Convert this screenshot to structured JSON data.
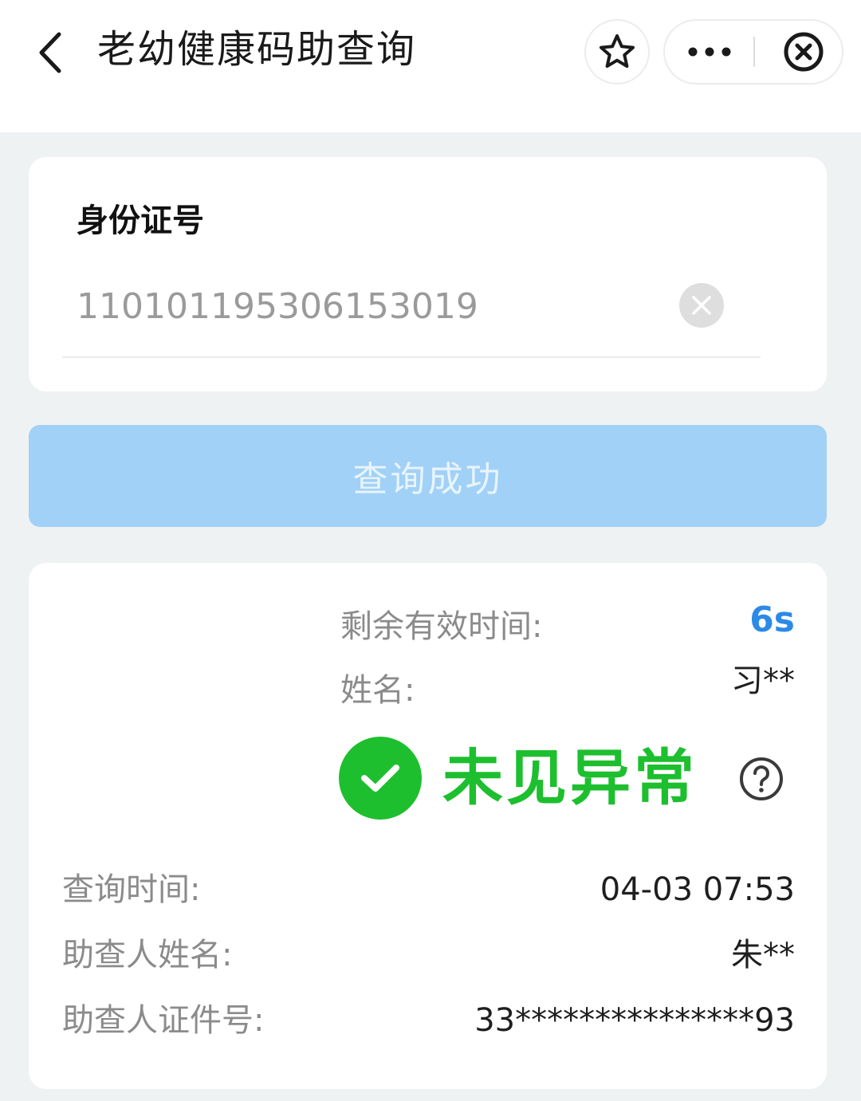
{
  "header": {
    "title": "老幼健康码助查询"
  },
  "id_section": {
    "label": "身份证号",
    "value": "110101195306153019"
  },
  "query_button": {
    "label": "查询成功"
  },
  "result": {
    "remaining_label": "剩余有效时间:",
    "remaining_value": "6s",
    "name_label": "姓名:",
    "name_value": "习**",
    "status_text": "未见异常",
    "query_time_label": "查询时间:",
    "query_time_value": "04-03 07:53",
    "helper_name_label": "助查人姓名:",
    "helper_name_value": "朱**",
    "helper_id_label": "助查人证件号:",
    "helper_id_value": "33***************93"
  },
  "colors": {
    "status_green": "#1dbf2e",
    "timer_blue": "#2b8ae6",
    "button_blue": "#a1d1f6",
    "page_bg": "#eff2f3"
  },
  "icons": {
    "back": "chevron-left-icon",
    "favorite": "star-outline-icon",
    "more": "ellipsis-icon",
    "close": "close-circle-icon",
    "clear": "clear-x-icon",
    "status": "check-circle-icon",
    "help": "question-circle-icon"
  }
}
